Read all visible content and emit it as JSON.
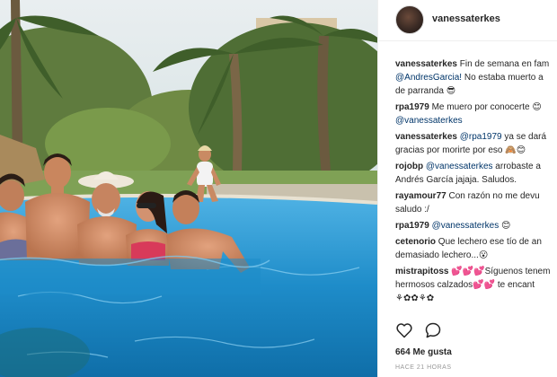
{
  "post": {
    "username": "vanessaterkes",
    "likes": "664 Me gusta",
    "time_ago": "HACE 21 HORAS"
  },
  "icons": {
    "like": "heart-icon",
    "comment": "speech-bubble-icon"
  },
  "colors": {
    "mention": "#003569",
    "text": "#262626",
    "muted": "#999999",
    "pool": "#1f87c6"
  },
  "comments": [
    {
      "user": "vanessaterkes",
      "lines": [
        [
          "",
          "Fin de semana en fam"
        ],
        [
          "@AndresGarcia!",
          " No estaba muerto a"
        ],
        [
          "",
          "de parranda 😎"
        ]
      ]
    },
    {
      "user": "rpa1979",
      "lines": [
        [
          "",
          "Me muero por conocerte 😊"
        ],
        [
          "@vanessaterkes",
          ""
        ]
      ]
    },
    {
      "user": "vanessaterkes",
      "lines": [
        [
          "@rpa1979",
          " ya se dará"
        ],
        [
          "",
          "gracias por morirte por eso 🙈😊"
        ]
      ]
    },
    {
      "user": "rojobp",
      "lines": [
        [
          "@vanessaterkes",
          " arrobaste a"
        ],
        [
          "",
          "Andrés García jajaja. Saludos."
        ]
      ]
    },
    {
      "user": "rayamour77",
      "lines": [
        [
          "",
          "Con razón no me devu"
        ],
        [
          "",
          "saludo :/"
        ]
      ]
    },
    {
      "user": "rpa1979",
      "lines": [
        [
          "@vanessaterkes",
          " 😊"
        ]
      ]
    },
    {
      "user": "cetenorio",
      "lines": [
        [
          "",
          "Que lechero ese tío de an"
        ],
        [
          "",
          "demasiado lechero...😮"
        ]
      ]
    },
    {
      "user": "mistrapitoss",
      "lines": [
        [
          "",
          "💕💕💕Síguenos tenem"
        ],
        [
          "",
          "hermosos calzados💕💕 te encant"
        ],
        [
          "",
          "⚘✿✿⚘✿"
        ]
      ]
    }
  ]
}
